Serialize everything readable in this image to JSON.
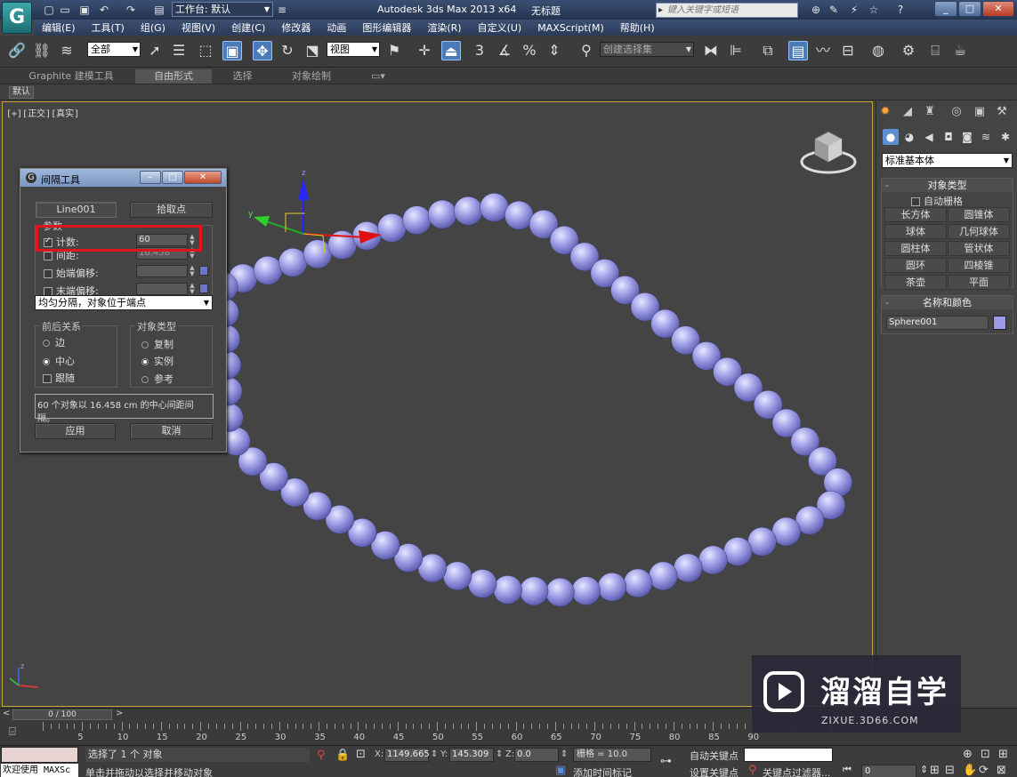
{
  "titlebar": {
    "logo": "G",
    "workspace": "工作台: 默认",
    "app_title": "Autodesk 3ds Max  2013 x64",
    "doc_title": "无标题",
    "search_placeholder": "键入关键字或短语"
  },
  "menu": [
    "编辑(E)",
    "工具(T)",
    "组(G)",
    "视图(V)",
    "创建(C)",
    "修改器",
    "动画",
    "图形编辑器",
    "渲染(R)",
    "自定义(U)",
    "MAXScript(M)",
    "帮助(H)"
  ],
  "toolbar": {
    "filter": "全部",
    "ref_coord": "视图",
    "named_selection": "创建选择集",
    "snap_labels": [
      "3",
      "%"
    ]
  },
  "ribbon": {
    "tabs": [
      "Graphite 建模工具",
      "自由形式",
      "选择",
      "对象绘制"
    ],
    "active_tab": 1,
    "default_label": "默认"
  },
  "viewport": {
    "label": "[+][正交][真实]",
    "bead_color": "#9b9be8"
  },
  "command_panel": {
    "category": "标准基本体",
    "object_type_title": "对象类型",
    "autogrid": "自动栅格",
    "objects": [
      "长方体",
      "圆锥体",
      "球体",
      "几何球体",
      "圆柱体",
      "管状体",
      "圆环",
      "四棱锥",
      "茶壶",
      "平面"
    ],
    "name_color_title": "名称和颜色",
    "object_name": "Sphere001",
    "object_color": "#9b9be8"
  },
  "spacing_tool": {
    "title": "间隔工具",
    "path_button": "Line001",
    "pick_points_button": "拾取点",
    "params_group": "参数",
    "count_label": "计数:",
    "count_value": "60",
    "spacing_label": "间距:",
    "spacing_value": "16.458",
    "start_offset_label": "始端偏移:",
    "end_offset_label": "末端偏移:",
    "distribution": "均匀分隔，对象位于端点",
    "context_group": "前后关系",
    "context_options": [
      "边",
      "中心",
      "跟随"
    ],
    "type_group": "对象类型",
    "type_options": [
      "复制",
      "实例",
      "参考"
    ],
    "message": "60 个对象以 16.458 cm 的中心间距间隔。",
    "apply_button": "应用",
    "cancel_button": "取消"
  },
  "timeline": {
    "slider": "0 / 100",
    "ticks": [
      "5",
      "10",
      "15",
      "20",
      "25",
      "30",
      "35",
      "40",
      "45",
      "50",
      "55",
      "60",
      "65",
      "70",
      "75",
      "80",
      "85",
      "90"
    ]
  },
  "status": {
    "welcome": "欢迎使用 MAXSc",
    "selected": "选择了 1 个 对象",
    "prompt": "单击并拖动以选择并移动对象",
    "x_label": "X:",
    "x": "1149.665",
    "y_label": "Y:",
    "y": "145.309",
    "z_label": "Z:",
    "z": "0.0",
    "grid": "栅格 = 10.0",
    "add_time_tag": "添加时间标记",
    "auto_key": "自动关键点",
    "set_key": "设置关键点",
    "key_filters": "关键点过滤器...",
    "frame": "0"
  },
  "watermark": {
    "title": "溜溜自学",
    "url": "ZIXUE.3D66.COM"
  }
}
